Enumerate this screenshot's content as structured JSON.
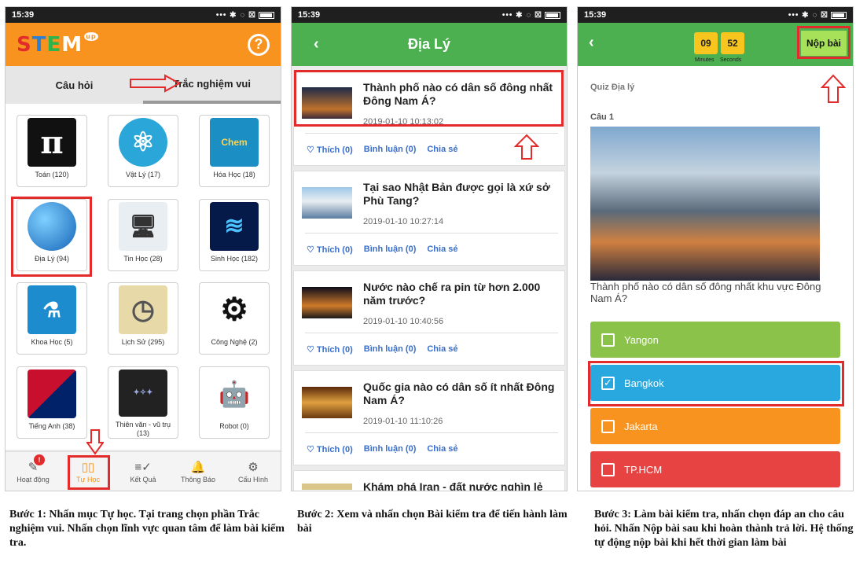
{
  "status_time": "15:39",
  "colors": {
    "orange": "#f7931e",
    "green": "#4caf50",
    "red": "#e32b2b"
  },
  "screen1": {
    "logo": "STEM",
    "logo_sup": "up",
    "help_icon": "question-circle-icon",
    "tabs": [
      "Câu hỏi",
      "Trắc nghiệm vui"
    ],
    "subjects": [
      {
        "label": "Toán (120)",
        "icon": "pi-icon"
      },
      {
        "label": "Vật Lý (17)",
        "icon": "atom-icon"
      },
      {
        "label": "Hóa Học (18)",
        "icon": "chemistry-icon"
      },
      {
        "label": "Địa Lý (94)",
        "icon": "globe-icon"
      },
      {
        "label": "Tin Học (28)",
        "icon": "computer-icon"
      },
      {
        "label": "Sinh Học (182)",
        "icon": "dna-icon"
      },
      {
        "label": "Khoa Học (5)",
        "icon": "science-globe-icon"
      },
      {
        "label": "Lịch Sử (295)",
        "icon": "clock-scroll-icon"
      },
      {
        "label": "Công Nghệ (2)",
        "icon": "gears-icon"
      },
      {
        "label": "Tiếng Anh (38)",
        "icon": "flag-icon"
      },
      {
        "label": "Thiên văn - vũ trụ (13)",
        "icon": "universe-icon"
      },
      {
        "label": "Robot (0)",
        "icon": "robot-icon"
      }
    ],
    "nav": [
      {
        "label": "Hoạt động",
        "icon": "activity-icon"
      },
      {
        "label": "Tự Học",
        "icon": "book-icon"
      },
      {
        "label": "Kết Quả",
        "icon": "results-icon"
      },
      {
        "label": "Thông Báo",
        "icon": "bell-icon"
      },
      {
        "label": "Cấu Hình",
        "icon": "gear-icon"
      }
    ],
    "badge": "!"
  },
  "screen2": {
    "title": "Địa Lý",
    "cards": [
      {
        "question": "Thành phố nào có dân số đông nhất Đông Nam Á?",
        "timestamp": "2019-01-10 10:13:02"
      },
      {
        "question": "Tại sao Nhật Bản được gọi là xứ sở Phù Tang?",
        "timestamp": "2019-01-10 10:27:14"
      },
      {
        "question": "Nước nào chế ra pin từ hơn 2.000 năm trước?",
        "timestamp": "2019-01-10 10:40:56"
      },
      {
        "question": "Quốc gia nào có dân số ít nhất Đông Nam Á?",
        "timestamp": "2019-01-10 11:10:26"
      },
      {
        "question": "Khám phá Iran - đất nước nghìn lẻ một",
        "timestamp": ""
      }
    ],
    "like": "♡ Thích (0)",
    "comment": "Bình luận (0)",
    "share": "Chia sẻ"
  },
  "screen3": {
    "minutes": "09",
    "seconds": "52",
    "minutes_label": "Minutes",
    "seconds_label": "Seconds",
    "submit": "Nộp bài",
    "quiz_title": "Quiz Địa lý",
    "question_number": "Câu 1",
    "question": "Thành phố nào có dân số đông nhất khu vực Đông Nam Á?",
    "options": [
      "Yangon",
      "Bangkok",
      "Jakarta",
      "TP.HCM"
    ]
  },
  "captions": {
    "step1": "Bước 1: Nhấn mục Tự học. Tại trang  chọn phần Trắc nghiệm vui. Nhấn chọn lĩnh vực quan tâm để làm bài kiểm tra.",
    "step2": "Bước 2: Xem và nhấn chọn Bài kiểm tra để tiến hành làm bài",
    "step3": "Bước 3: Làm bài kiểm tra, nhấn chọn đáp an cho câu hỏi. Nhấn Nộp bài sau khi hoàn thành trả lời. Hệ thống tự động nộp bài khi hết thời gian làm bài"
  }
}
